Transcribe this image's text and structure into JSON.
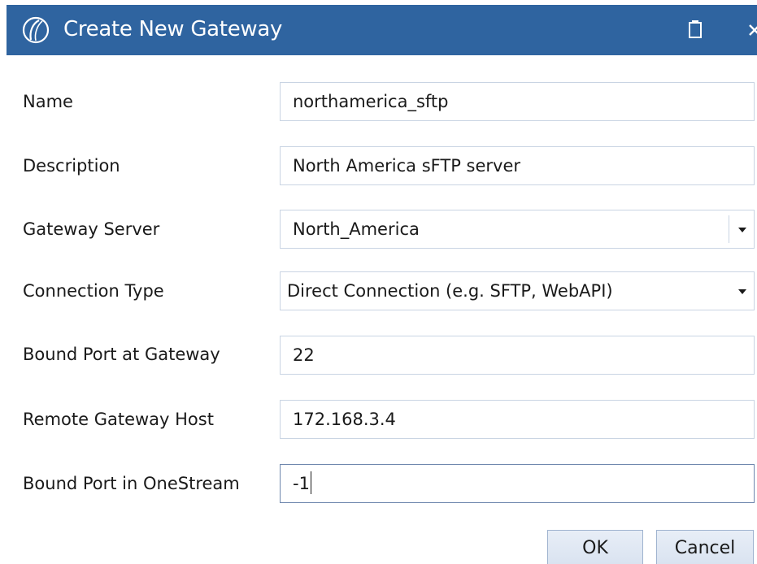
{
  "window": {
    "title": "Create New Gateway"
  },
  "colors": {
    "titlebar": "#2f64a0",
    "field_border": "#c9d4e3",
    "button_bg": "#dde6f2"
  },
  "icons": {
    "app": "onestream-logo-icon",
    "maximize": "maximize-icon",
    "close": "close-icon",
    "dropdown": "chevron-down-icon"
  },
  "form": {
    "name": {
      "label": "Name",
      "value": "northamerica_sftp"
    },
    "description": {
      "label": "Description",
      "value": "North America sFTP server"
    },
    "gateway_server": {
      "label": "Gateway Server",
      "value": "North_America"
    },
    "connection_type": {
      "label": "Connection Type",
      "value": "Direct Connection (e.g. SFTP, WebAPI)"
    },
    "bound_port_gateway": {
      "label": "Bound Port at Gateway",
      "value": "22"
    },
    "remote_gateway_host": {
      "label": "Remote Gateway Host",
      "value": "172.168.3.4"
    },
    "bound_port_onestream": {
      "label": "Bound Port in OneStream",
      "value": "-1"
    }
  },
  "buttons": {
    "ok": "OK",
    "cancel": "Cancel"
  }
}
